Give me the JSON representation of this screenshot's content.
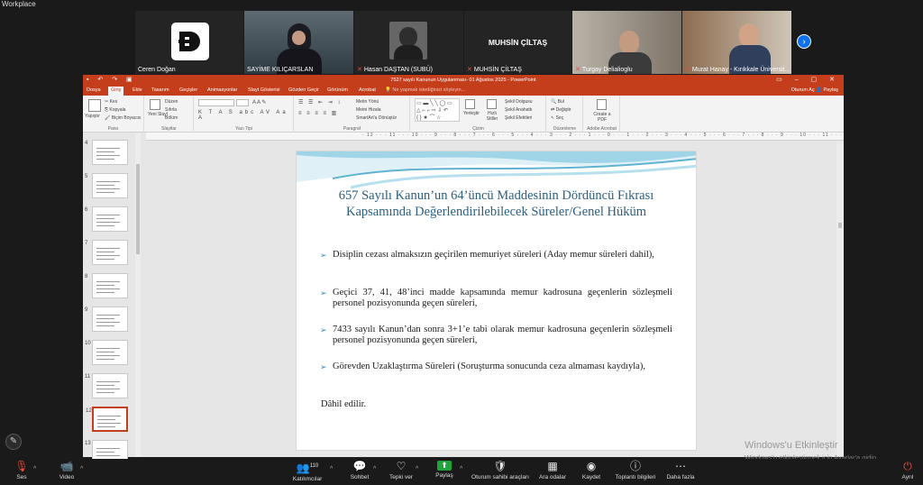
{
  "app": {
    "top_label": "Workplace"
  },
  "participants": [
    {
      "name": "Ceren Doğan",
      "muted": false
    },
    {
      "name": "SAYİME KILIÇARSLAN",
      "muted": false
    },
    {
      "name": "Hasan DAŞTAN (SUBÜ)",
      "muted": true
    },
    {
      "name": "MUHSİN ÇİLTAŞ",
      "muted": true,
      "display_name": "MUHSİN ÇİLTAŞ"
    },
    {
      "name": "Turgay Delialioglu",
      "muted": true
    },
    {
      "name": "Murat Hanay - Kırıkkale Üniversit...",
      "muted": true
    }
  ],
  "ppt": {
    "window_title": "7527 sayılı Kanunun Uygulanması- 01 Ağustos 2025 - PowerPoint",
    "search_placeholder": "Ne yapmak istediğinizi söyleyin...",
    "tabs": [
      "Dosya",
      "Giriş",
      "Ekle",
      "Tasarım",
      "Geçişler",
      "Animasyonlar",
      "Slayt Gösterisi",
      "Gözden Geçir",
      "Görünüm",
      "Acrobat"
    ],
    "account": "Oturum Aç",
    "share": "Paylaş",
    "ribbon_groups": [
      "Pano",
      "Slaytlar",
      "Yazı Tipi",
      "Paragraf",
      "Çizim",
      "Düzenleme",
      "Adobe Acrobat"
    ],
    "ribbon_buttons": {
      "paste": "Yapıştır",
      "cut": "Kes",
      "copy": "Kopyala",
      "format_painter": "Biçim Boyacısı",
      "new_slide": "Yeni Slayt",
      "layout": "Düzen",
      "reset": "Sıfırla",
      "section": "Bölüm",
      "text_direction": "Metin Yönü",
      "align_text": "Metni Hizala",
      "smartart": "SmartArt'a Dönüştür",
      "arrange": "Yerleştir",
      "quick_styles": "Hızlı Stiller",
      "shape_fill": "Şekil Dolgusu",
      "shape_outline": "Şekil Anahattı",
      "shape_effects": "Şekil Efektleri",
      "find": "Bul",
      "replace": "Değiştir",
      "select": "Seç",
      "create_pdf": "Create a PDF"
    },
    "ruler": "· 12 · · · 11 · · · 10 · · · 9 · · · 8 · · · 7 · · · 6 · · · 5 · · · 4 · · · 3 · · · 2 · · · 1 · · · 0 · · · 1 · · · 2 · · · 3 · · · 4 · · · 5 · · · 6 · · · 7 · · · 8 · · · 9 · · · 10 · · · 11 · · · 12",
    "thumbnails": [
      "4",
      "5",
      "6",
      "7",
      "8",
      "9",
      "10",
      "11",
      "12",
      "13"
    ],
    "current_slide": "12"
  },
  "slide": {
    "title_line1": "657 Sayılı Kanun’un 64’üncü Maddesinin Dördüncü Fıkrası",
    "title_line2": "Kapsamında Değerlendirilebilecek Süreler/Genel Hüküm",
    "bullets": [
      "Disiplin cezası almaksızın geçirilen memuriyet süreleri (Aday memur süreleri dahil),",
      "Geçici 37, 41, 48’inci madde kapsamında memur kadrosuna geçenlerin sözleşmeli personel pozisyonunda geçen süreleri,",
      "7433 sayılı Kanun’dan sonra 3+1’e tabi olarak memur kadrosuna geçenlerin sözleşmeli personel pozisyonunda geçen süreleri,",
      "Görevden Uzaklaştırma Süreleri (Soruşturma sonucunda ceza almaması kaydıyla),"
    ],
    "closing": "Dâhil edilir."
  },
  "watermark": {
    "line1": "Windows'u Etkinleştir",
    "line2": "Windows'u etkinleştirmek için Ayarlar'a gidin."
  },
  "zoom_toolbar": {
    "mute": "Ses",
    "video": "Video",
    "participants": "Katılımcılar",
    "participant_count": "110",
    "chat": "Sohbet",
    "reactions": "Tepki ver",
    "share": "Paylaş",
    "host_tools": "Oturum sahibi araçları",
    "breakout": "Ara odalar",
    "record": "Kaydet",
    "meeting_info": "Toplantı bilgileri",
    "more": "Daha fazla",
    "leave": "Ayrıl"
  }
}
